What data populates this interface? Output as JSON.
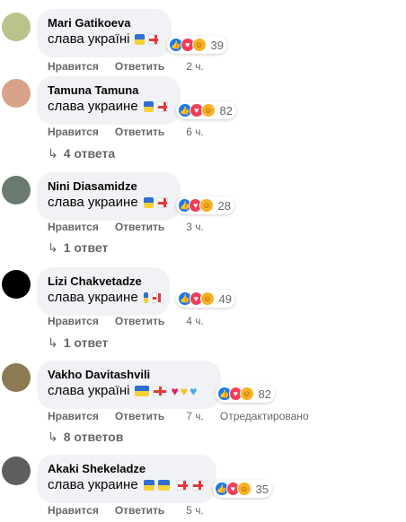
{
  "labels": {
    "like": "Нравится",
    "reply": "Ответить"
  },
  "comments": [
    {
      "author": "Mari Gatikoeva",
      "text": "слава україні",
      "reactions": "39",
      "time": "2 ч.",
      "edited": "",
      "replies": ""
    },
    {
      "author": "Tamuna Tamuna",
      "text": "слава украине",
      "reactions": "82",
      "time": "6 ч.",
      "edited": "",
      "replies": "4 ответа"
    },
    {
      "author": "Nini Diasamidze",
      "text": "слава украине",
      "reactions": "28",
      "time": "3 ч.",
      "edited": "",
      "replies": "1 ответ"
    },
    {
      "author": "Lizi Chakvetadze",
      "text": "слава украине",
      "reactions": "49",
      "time": "4 ч.",
      "edited": "",
      "replies": "1 ответ"
    },
    {
      "author": "Vakho Davitashvili",
      "text": "слава україні",
      "reactions": "82",
      "time": "7 ч.",
      "edited": "Отредактировано",
      "replies": "8 ответов"
    },
    {
      "author": "Akaki Shekeladze",
      "text": "слава украине",
      "reactions": "35",
      "time": "5 ч.",
      "edited": "",
      "replies": ""
    }
  ],
  "colors": {
    "bubble": "#f0f2f5",
    "secondary_text": "#65676b",
    "like": "#1877f2",
    "love": "#f33e58",
    "care": "#f7b125"
  }
}
